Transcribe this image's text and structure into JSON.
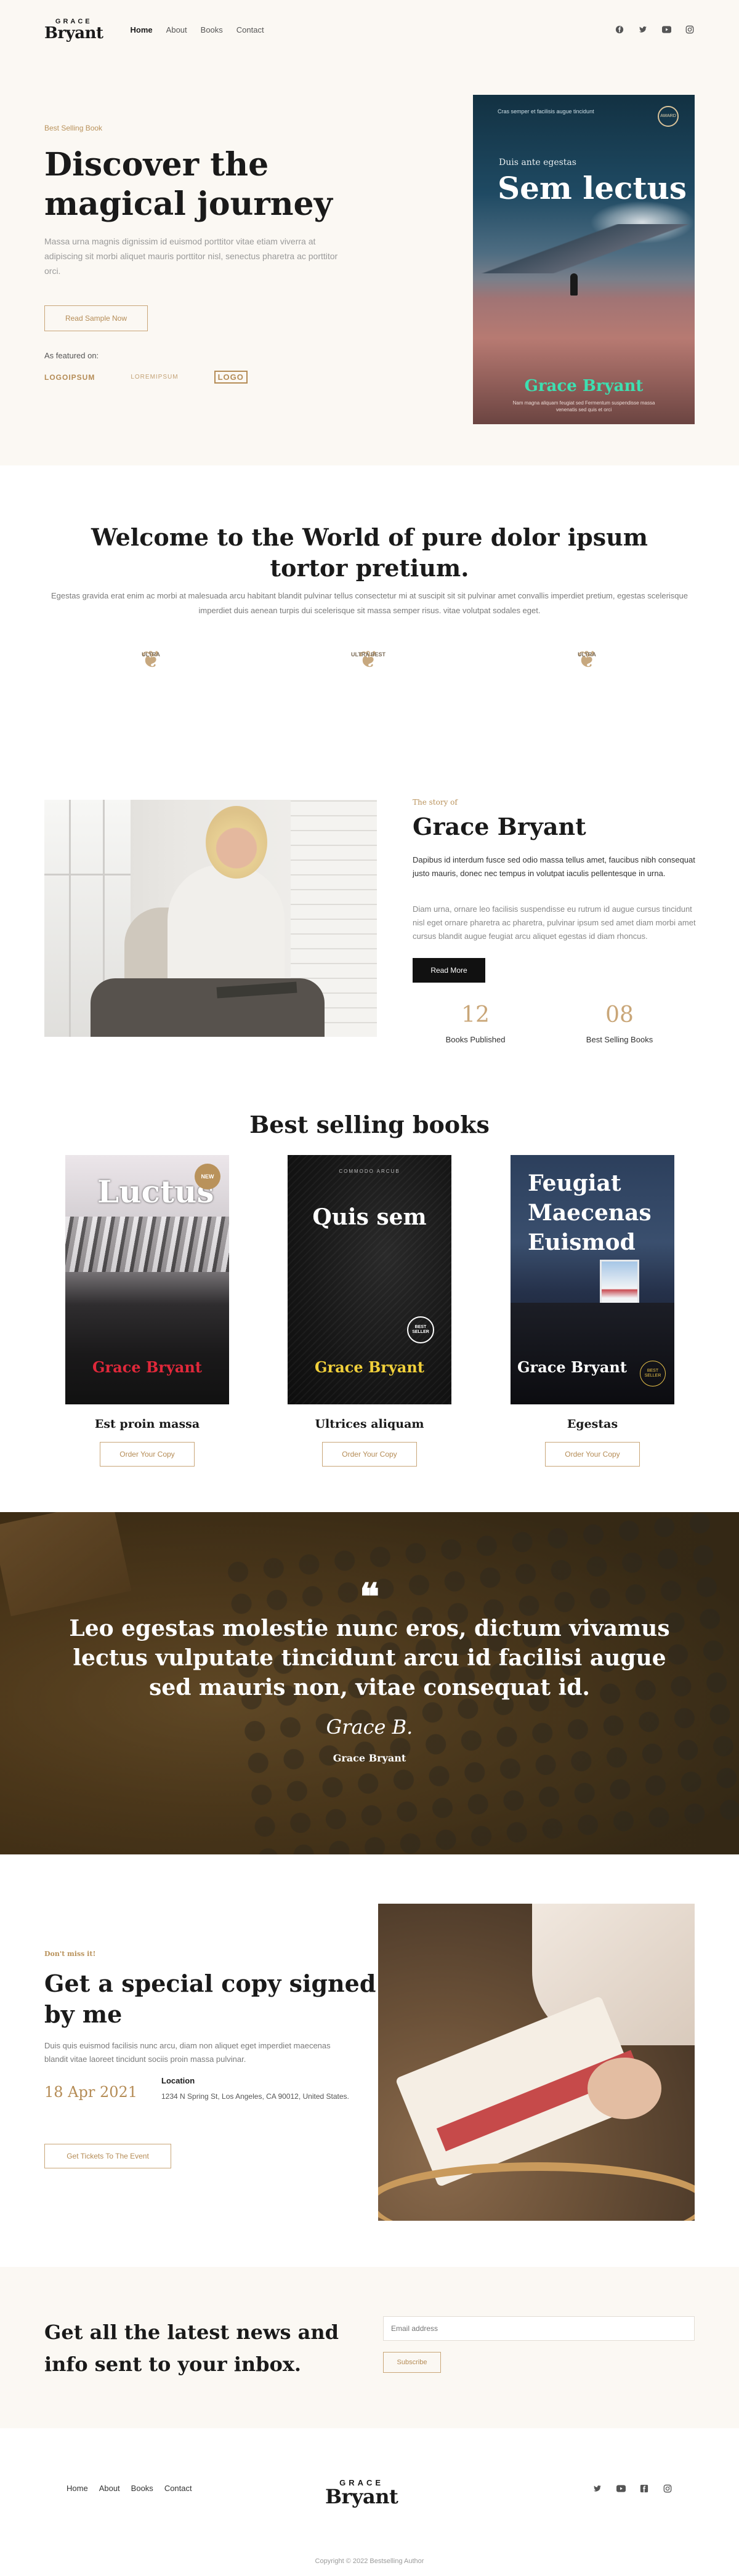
{
  "header": {
    "logo_top": "GRACE",
    "logo_bottom": "Bryant",
    "nav": [
      "Home",
      "About",
      "Books",
      "Contact"
    ],
    "social_icons": [
      "facebook-icon",
      "twitter-icon",
      "youtube-icon",
      "instagram-icon"
    ]
  },
  "hero": {
    "eyebrow": "Best Selling Book",
    "title": "Discover the magical journey",
    "description": "Massa urna magnis dignissim id euismod porttitor vitae etiam viverra at adipiscing sit morbi aliquet mauris porttitor nisl, senectus pharetra ac porttitor orci.",
    "button": "Read Sample Now",
    "featured_label": "As featured on:",
    "featured_logos": [
      "LOGOIPSUM",
      "LOREMIPSUM",
      "LOGO"
    ],
    "book": {
      "caption": "Cras semper et facilisis augue tincidunt",
      "badge": "AWARD",
      "subtitle": "Duis ante egestas",
      "title": "Sem lectus",
      "author": "Grace Bryant",
      "blurb": "Nam magna aliquam feugiat sed Fermentum suspendisse massa venenatis sed quis et orci"
    }
  },
  "welcome": {
    "title": "Welcome to the World of pure dolor ipsum tortor pretium.",
    "text": "Egestas gravida erat enim ac morbi at malesuada arcu habitant blandit pulvinar tellus consectetur mi at suscipit sit sit pulvinar amet convallis imperdiet pretium, egestas scelerisque imperdiet duis aenean turpis dui scelerisque sit massa semper risus. vitae volutpat sodales eget.",
    "awards": [
      "ULTRA",
      "ULTRA BEST",
      "ULTRA"
    ]
  },
  "story": {
    "eyebrow": "The story of",
    "name": "Grace Bryant",
    "p1": "Dapibus id interdum fusce sed odio massa tellus amet, faucibus nibh consequat justo mauris, donec nec tempus in volutpat iaculis pellentesque in urna.",
    "p2": "Diam urna, ornare leo facilisis suspendisse eu rutrum id augue cursus tincidunt nisl eget ornare pharetra ac pharetra, pulvinar ipsum sed amet diam morbi amet cursus blandit augue feugiat arcu aliquet egestas id diam rhoncus.",
    "button": "Read More",
    "stats": [
      {
        "number": "12",
        "label": "Books Published"
      },
      {
        "number": "08",
        "label": "Best Selling Books"
      }
    ]
  },
  "best": {
    "title": "Best selling books",
    "books": [
      {
        "cover_title": "Luctus",
        "author": "Grace Bryant",
        "name": "Est proin massa",
        "button": "Order Your Copy",
        "badge": "NEW"
      },
      {
        "cover_title": "Quis sem",
        "author": "Grace Bryant",
        "name": "Ultrices aliquam",
        "button": "Order Your Copy",
        "top": "COMMODO ARCUB",
        "badge": "BEST SELLER"
      },
      {
        "cover_title": "Feugiat Maecenas Euismod",
        "author": "Grace Bryant",
        "name": "Egestas",
        "button": "Order Your Copy",
        "badge": "BEST SELLER"
      }
    ]
  },
  "quote": {
    "mark": "❝",
    "text": "Leo egestas molestie nunc eros, dictum vivamus lectus vulputate tincidunt arcu id facilisi augue sed mauris non, vitae consequat id.",
    "signature": "Grace B.",
    "author": "Grace Bryant"
  },
  "signed": {
    "eyebrow": "Don't miss it!",
    "title": "Get a special copy signed by me",
    "text": "Duis quis euismod facilisis nunc arcu, diam non aliquet eget imperdiet maecenas blandit vitae laoreet tincidunt sociis proin massa pulvinar.",
    "date": "18 Apr 2021",
    "location_label": "Location",
    "location": "1234 N Spring St, Los Angeles, CA 90012, United States.",
    "button": "Get Tickets To The Event"
  },
  "newsletter": {
    "title": "Get all the latest news and info sent to your inbox.",
    "placeholder": "Email address",
    "button": "Subscribe"
  },
  "footer": {
    "nav": [
      "Home",
      "About",
      "Books",
      "Contact"
    ],
    "logo_top": "GRACE",
    "logo_bottom": "Bryant",
    "social_icons": [
      "twitter-icon",
      "youtube-icon",
      "facebook-icon",
      "instagram-icon"
    ],
    "copyright": "Copyright © 2022 Bestselling Author"
  },
  "colors": {
    "accent": "#c9a678",
    "cream": "#fbf8f3",
    "dark": "#111111"
  }
}
